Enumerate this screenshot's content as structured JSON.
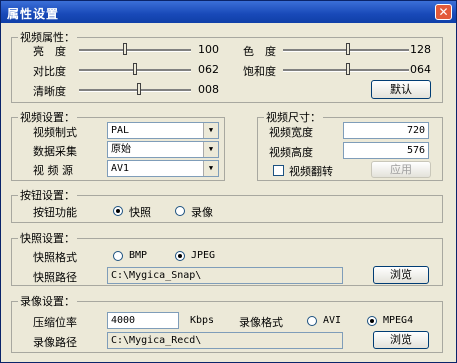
{
  "window": {
    "title": "属性设置",
    "close_icon": "✕"
  },
  "video_props": {
    "legend": "视频属性：",
    "brightness": {
      "label": "亮　度",
      "value": "100"
    },
    "hue": {
      "label": "色　度",
      "value": "128"
    },
    "contrast": {
      "label": "对比度",
      "value": "062"
    },
    "saturation": {
      "label": "饱和度",
      "value": "064"
    },
    "sharpness": {
      "label": "清晰度",
      "value": "008"
    },
    "default_button": "默认"
  },
  "video_settings": {
    "legend": "视频设置：",
    "format": {
      "label": "视频制式",
      "value": "PAL"
    },
    "capture": {
      "label": "数据采集",
      "value": "原始"
    },
    "source": {
      "label": "视 频 源",
      "value": "AV1"
    }
  },
  "video_size": {
    "legend": "视频尺寸：",
    "width": {
      "label": "视频宽度",
      "value": "720"
    },
    "height": {
      "label": "视频高度",
      "value": "576"
    },
    "flip_label": "视频翻转",
    "apply_button": "应用"
  },
  "button_settings": {
    "legend": "按钮设置：",
    "function_label": "按钮功能",
    "snapshot": "快照",
    "record": "录像"
  },
  "snapshot_settings": {
    "legend": "快照设置：",
    "format_label": "快照格式",
    "bmp": "BMP",
    "jpeg": "JPEG",
    "path_label": "快照路径",
    "path": "C:\\Mygica_Snap\\",
    "browse": "浏览"
  },
  "record_settings": {
    "legend": "录像设置：",
    "bitrate_label": "压缩位率",
    "bitrate": "4000",
    "unit": "Kbps",
    "format_label": "录像格式",
    "avi": "AVI",
    "mpeg4": "MPEG4",
    "path_label": "录像路径",
    "path": "C:\\Mygica_Recd\\",
    "browse": "浏览"
  }
}
